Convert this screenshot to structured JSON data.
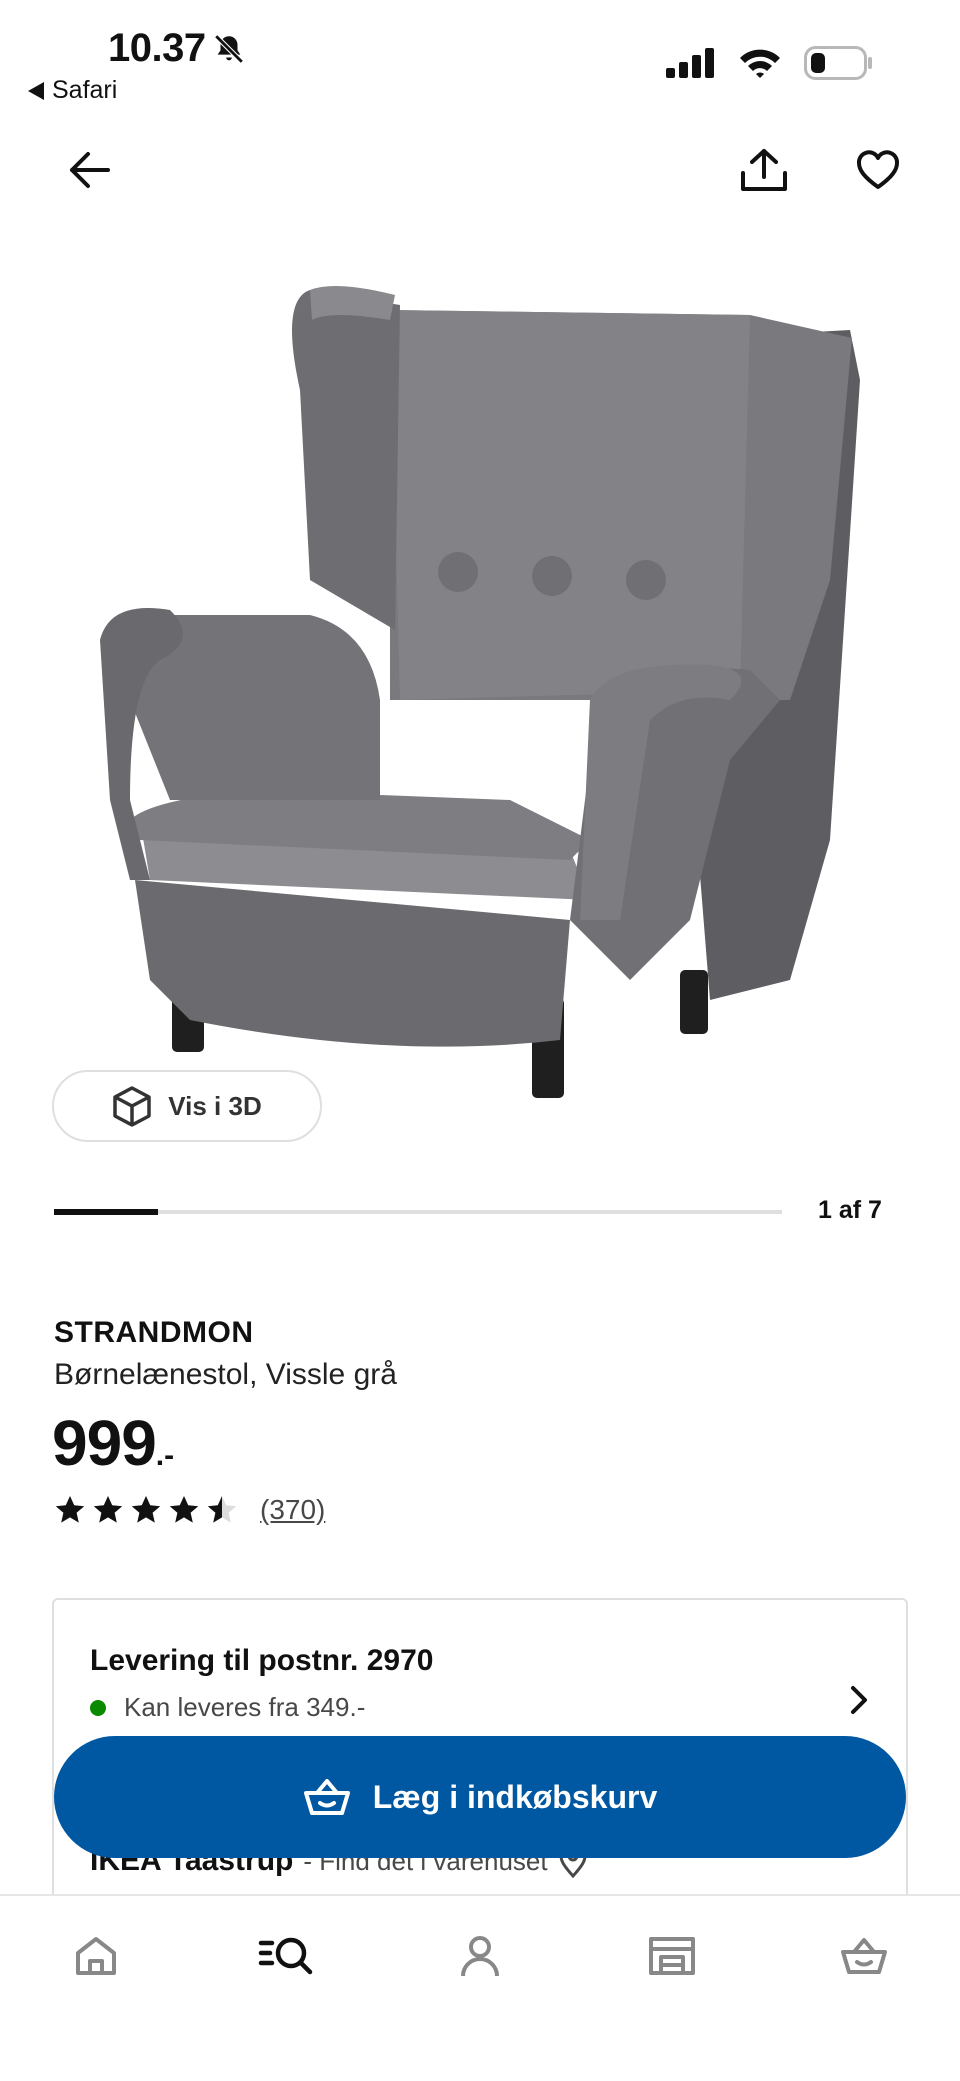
{
  "status_bar": {
    "time": "10.37",
    "back_app": "Safari"
  },
  "product": {
    "name": "STRANDMON",
    "description": "Børnelænestol, Vissle grå",
    "price": "999",
    "price_suffix": ".-",
    "rating": 4.5,
    "review_count": "(370)",
    "view_3d_label": "Vis i 3D",
    "carousel_position": "1 af 7",
    "carousel_progress": 0.143
  },
  "delivery": {
    "title": "Levering til postnr. 2970",
    "status": "Kan leveres fra 349.-",
    "status_color": "#0a8a00",
    "store_name": "IKEA Taastrup",
    "store_hint": " - Find det i varehuset"
  },
  "cart_button": {
    "label": "Læg i indkøbskurv",
    "color": "#0058a3"
  },
  "tabs": [
    "home-icon",
    "search-icon",
    "profile-icon",
    "store-icon",
    "basket-icon"
  ]
}
